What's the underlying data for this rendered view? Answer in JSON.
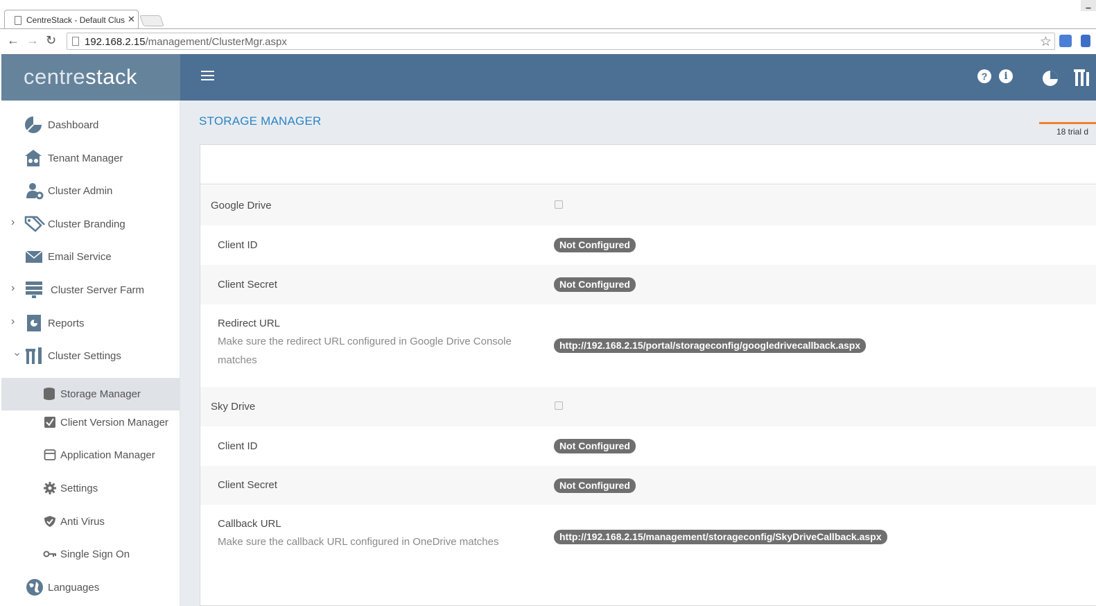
{
  "browser": {
    "tab_title": "CentreStack - Default Clus",
    "url_host": "192.168.2.15",
    "url_path": "/management/ClusterMgr.aspx"
  },
  "brand": {
    "part1": "centre",
    "part2": "stack"
  },
  "topbar": {
    "help_glyph": "?",
    "info_glyph": "i"
  },
  "sidebar": {
    "items": [
      {
        "label": "Dashboard",
        "icon": "dashboard-pie-icon"
      },
      {
        "label": "Tenant Manager",
        "icon": "tenant-building-icon"
      },
      {
        "label": "Cluster Admin",
        "icon": "admin-user-gear-icon"
      },
      {
        "label": "Cluster Branding",
        "icon": "tags-icon"
      },
      {
        "label": "Email Service",
        "icon": "envelope-icon"
      },
      {
        "label": "Cluster Server Farm",
        "icon": "server-rack-icon"
      },
      {
        "label": "Reports",
        "icon": "report-icon"
      },
      {
        "label": "Cluster Settings",
        "icon": "tools-icon"
      },
      {
        "label": "Storage Manager",
        "icon": "database-icon"
      },
      {
        "label": "Client Version Manager",
        "icon": "check-box-icon"
      },
      {
        "label": "Application Manager",
        "icon": "window-icon"
      },
      {
        "label": "Settings",
        "icon": "gear-icon"
      },
      {
        "label": "Anti Virus",
        "icon": "shield-check-icon"
      },
      {
        "label": "Single Sign On",
        "icon": "key-icon"
      },
      {
        "label": "Languages",
        "icon": "globe-icon"
      }
    ]
  },
  "page": {
    "title": "STORAGE MANAGER",
    "trial_text": "18 trial d"
  },
  "google_drive": {
    "label": "Google Drive",
    "client_id_label": "Client ID",
    "client_id_value": "Not Configured",
    "client_secret_label": "Client Secret",
    "client_secret_value": "Not Configured",
    "redirect_label": "Redirect URL",
    "redirect_hint": "Make sure the redirect URL configured in Google Drive Console matches",
    "redirect_value": "http://192.168.2.15/portal/storageconfig/googledrivecallback.aspx"
  },
  "sky_drive": {
    "label": "Sky Drive",
    "client_id_label": "Client ID",
    "client_id_value": "Not Configured",
    "client_secret_label": "Client Secret",
    "client_secret_value": "Not Configured",
    "callback_label": "Callback URL",
    "callback_hint": "Make sure the callback URL configured in OneDrive matches",
    "callback_value": "http://192.168.2.15/management/storageconfig/SkyDriveCallback.aspx"
  },
  "colors": {
    "topbar": "#4c7094",
    "brand_bg": "#66839c",
    "accent_title": "#2a84c6",
    "trial_bar": "#f0812b",
    "badge_bg": "#6f6f6f"
  }
}
